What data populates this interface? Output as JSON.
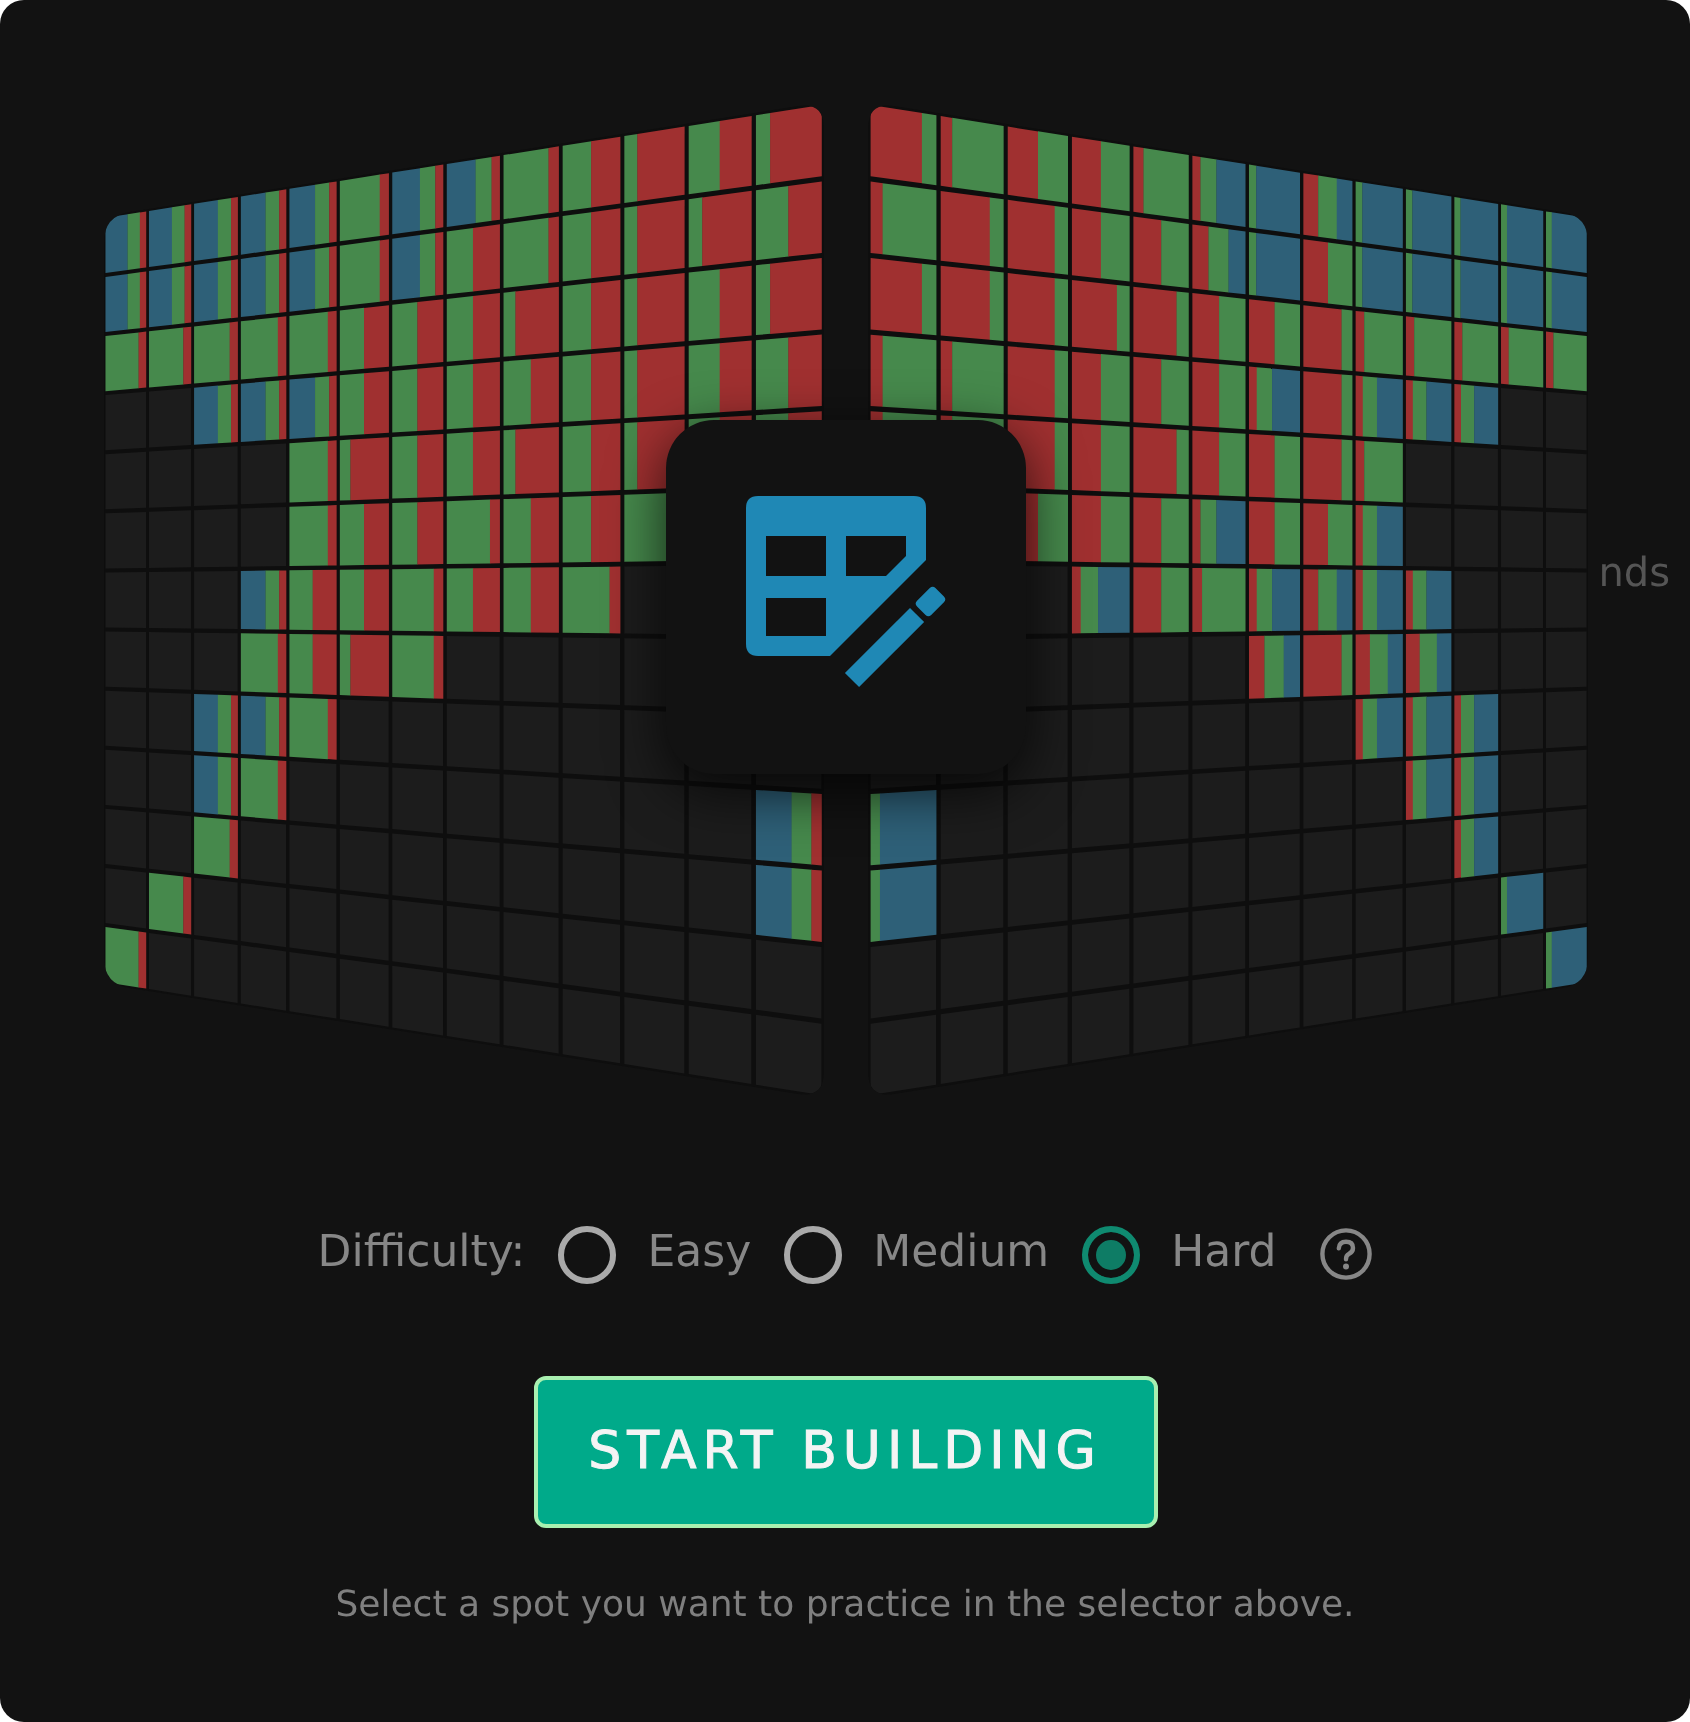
{
  "background_text_fragment": "nds",
  "difficulty": {
    "label": "Difficulty:",
    "options": [
      {
        "label": "Easy",
        "selected": false
      },
      {
        "label": "Medium",
        "selected": false
      },
      {
        "label": "Hard",
        "selected": true
      }
    ]
  },
  "start_button": {
    "label": "START BUILDING"
  },
  "hint": "Select a spot you want to practice in the selector above."
}
